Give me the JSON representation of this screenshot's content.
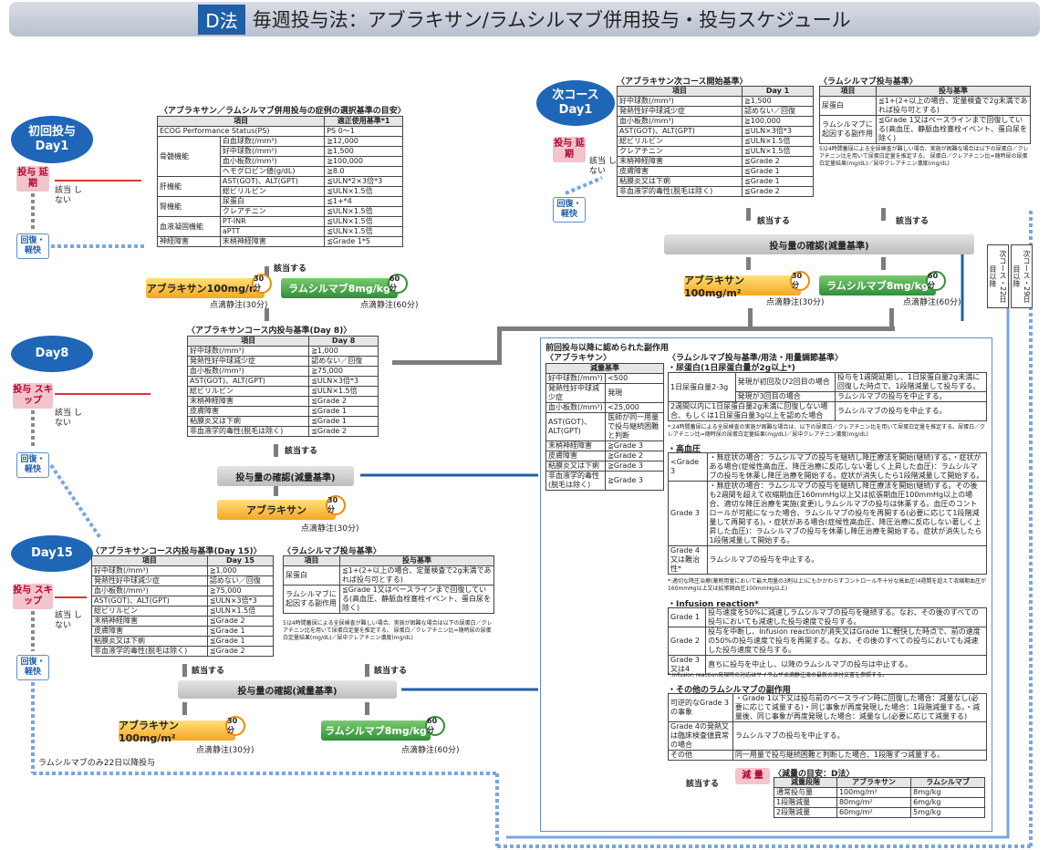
{
  "banner": {
    "tag": "D法",
    "title": "毎週投与法：アブラキサン/ラムシルマブ併用投与・投与スケジュール"
  },
  "labels": {
    "day1": "初回投与 Day1",
    "day8": "Day8",
    "day15": "Day15",
    "next_day1": "次コース Day1",
    "delay": "投与 延期",
    "skip": "投与 スキップ",
    "recovery": "回復・ 軽快",
    "applicable": "該当する",
    "not_applicable": "該当 しない",
    "dose_check": "投与量の確認(減量基準)",
    "next_22": "次コース・22日目以降",
    "next_29": "次コース・29日目以降",
    "ram_only_22": "ラムシルマブのみ22日以降投与",
    "badge30": "30分",
    "badge60": "60分"
  },
  "drugs": {
    "abx100": "アブラキサン100mg/m²",
    "ram8": "ラムシルマブ8mg/kg",
    "abx": "アブラキサン",
    "drip30": "点滴静注(30分)",
    "drip60": "点滴静注(60分)",
    "reduce": "減 量"
  },
  "sel_criteria": {
    "title": "〈アブラキサン／ラムシルマブ併用投与の症例の選択基準の目安〉",
    "head": [
      "項目",
      "適正使用基準*1"
    ],
    "rows": [
      [
        "ECOG Performance Status(PS)",
        "",
        "PS 0〜1"
      ],
      [
        "骨髄機能",
        "白血球数(/mm³)",
        "≧12,000"
      ],
      [
        "",
        "好中球数(/mm³)",
        "≧1,500"
      ],
      [
        "",
        "血小板数(/mm³)",
        "≧100,000"
      ],
      [
        "",
        "ヘモグロビン値(g/dL)",
        "≧8.0"
      ],
      [
        "肝機能",
        "AST(GOT)、ALT(GPT)",
        "≦ULN*2×3倍*3"
      ],
      [
        "",
        "総ビリルビン",
        "≦ULN×1.5倍"
      ],
      [
        "腎機能",
        "尿蛋白",
        "≦1+*4"
      ],
      [
        "",
        "クレアチニン",
        "≦ULN×1.5倍"
      ],
      [
        "血液凝固機能",
        "PT-INR",
        "≦ULN×1.5倍"
      ],
      [
        "",
        "aPTT",
        "≦ULN×1.5倍"
      ],
      [
        "神経障害",
        "末梢神経障害",
        "≦Grade 1*5"
      ]
    ]
  },
  "abx_day8": {
    "title": "〈アブラキサンコース内投与基準(Day 8)〉",
    "head": [
      "項目",
      "Day 8"
    ],
    "rows": [
      [
        "好中球数(/mm³)",
        "≧1,000"
      ],
      [
        "発熱性好中球減少症",
        "認めない／回復"
      ],
      [
        "血小板数(/mm³)",
        "≧75,000"
      ],
      [
        "AST(GOT)、ALT(GPT)",
        "≦ULN×3倍*3"
      ],
      [
        "総ビリルビン",
        "≦ULN×1.5倍"
      ],
      [
        "末梢神経障害",
        "≦Grade 2"
      ],
      [
        "皮膚障害",
        "≦Grade 1"
      ],
      [
        "粘膜炎又は下痢",
        "≦Grade 1"
      ],
      [
        "非血液学的毒性(脱毛は除く)",
        "≦Grade 2"
      ]
    ]
  },
  "abx_day15": {
    "title": "〈アブラキサンコース内投与基準(Day 15)〉",
    "head": [
      "項目",
      "Day 15"
    ],
    "rows": [
      [
        "好中球数(/mm³)",
        "≧1,000"
      ],
      [
        "発熱性好中球減少症",
        "認めない／回復"
      ],
      [
        "血小板数(/mm³)",
        "≧75,000"
      ],
      [
        "AST(GOT)、ALT(GPT)",
        "≦ULN×3倍*3"
      ],
      [
        "総ビリルビン",
        "≦ULN×1.5倍"
      ],
      [
        "末梢神経障害",
        "≦Grade 2"
      ],
      [
        "皮膚障害",
        "≦Grade 1"
      ],
      [
        "粘膜炎又は下痢",
        "≦Grade 1"
      ],
      [
        "非血液学的毒性(脱毛は除く)",
        "≦Grade 2"
      ]
    ]
  },
  "abx_next": {
    "title": "〈アブラキサン次コース開始基準〉",
    "head": [
      "項目",
      "Day 1"
    ],
    "rows": [
      [
        "好中球数(/mm³)",
        "≧1,500"
      ],
      [
        "発熱性好中球減少症",
        "認めない／回復"
      ],
      [
        "血小板数(/mm³)",
        "≧100,000"
      ],
      [
        "AST(GOT)、ALT(GPT)",
        "≦ULN×3倍*3"
      ],
      [
        "総ビリルビン",
        "≦ULN×1.5倍"
      ],
      [
        "クレアチニン",
        "≦ULN×1.5倍"
      ],
      [
        "末梢神経障害",
        "≦Grade 2"
      ],
      [
        "皮膚障害",
        "≦Grade 1"
      ],
      [
        "粘膜炎又は下痢",
        "≦Grade 1"
      ],
      [
        "非血液学的毒性(脱毛は除く)",
        "≦Grade 2"
      ]
    ]
  },
  "ram_crit": {
    "title": "〈ラムシルマブ投与基準〉",
    "head": [
      "項目",
      "投与基準"
    ],
    "rows": [
      [
        "尿蛋白",
        "≦1+(2+以上の場合、定量検査で2g未満であれば投与可とする)"
      ],
      [
        "ラムシルマブに起因する副作用",
        "≦Grade 1又はベースラインまで回復している(高血圧、静脈血栓塞栓イベント、蛋白尿を除く)"
      ]
    ],
    "note": "5)24時間蓄尿による全尿検査が難しい場合、実施が困難な場合は以下の尿蛋白／クレアチニン比を用いて尿蛋白定量を推定する。 尿蛋白／クレアチニン比=随時尿の尿蛋白定量結果(mg/dL)／尿中クレアチニン濃度(mg/dL)"
  },
  "adverse": {
    "title": "前回投与以降に認められた副作用",
    "abx_label": "〈アブラキサン〉",
    "abx_head": "減量基準",
    "abx_rows": [
      [
        "好中球数(/mm³)",
        "<500"
      ],
      [
        "発熱性好中球減少症",
        "発現"
      ],
      [
        "血小板数(/mm³)",
        "<25,000"
      ],
      [
        "AST(GOT)、ALT(GPT)",
        "医師が同一用量で投与継続困難と判断"
      ],
      [
        "末梢神経障害",
        "≧Grade 3"
      ],
      [
        "皮膚障害",
        "≧Grade 2"
      ],
      [
        "粘膜炎又は下痢",
        "≧Grade 3"
      ],
      [
        "非血液学的毒性(脱毛は除く)",
        "≧Grade 3"
      ]
    ],
    "ram_title": "〈ラムシルマブ投与基準/用法・用量調節基準〉",
    "proteinuria_title": "・尿蛋白(1日尿蛋白量が2g以上*)",
    "proteinuria": [
      [
        "1日尿蛋白量2-3g",
        "発現が初回及び2回目の場合",
        "投与を1週間延期し、1日尿蛋白量2g未満に回復した時点で、1段階減量して投与する。"
      ],
      [
        "",
        "発現が3回目の場合",
        "ラムシルマブの投与を中止する。"
      ],
      [
        "2週間以内に1日尿蛋白量2g未満に回復しない場合、もしくは1日尿蛋白量3g以上を認めた場合",
        "",
        "ラムシルマブの投与を中止する。"
      ]
    ],
    "proteinuria_note": "*:24時間蓄尿による全尿検査の実施が困難な場合は、以下の尿蛋白／クレアチニン比を用いて尿蛋白定量を推定する。尿蛋白／クレアチニン比=随時尿の尿蛋白定量結果(mg/dL)／尿中クレアチニン濃度(mg/dL)",
    "hyper_title": "・高血圧",
    "hyper": [
      [
        "<Grade 3",
        "・無症状の場合：ラムシルマブの投与を継続し降圧療法を開始(継続)する。・症状がある場合(症候性高血圧、降圧治療に反応しない著しく上昇した血圧)：ラムシルマブの投与を休薬し降圧治療を開始する。症状が消失したら1段階減量して開始する。"
      ],
      [
        "Grade 3",
        "・無症状の場合：ラムシルマブの投与を継続し降圧療法を開始(継続)する。その後も2週間を超えて収縮期血圧160mmHg以上又は拡張期血圧100mmHg以上の場合、適切な降圧治療を実施(変更)しラムシルマブの投与は休薬する。血圧のコントロールが可能になった場合、ラムシルマブの投与を再開する(必要に応じて1段階減量して再開する)。・症状がある場合(症候性高血圧、降圧治療に反応しない著しく上昇した血圧)：ラムシルマブの投与を休薬し降圧治療を開始する。症状が消失したら1段階減量して開始する。"
      ],
      [
        "Grade 4又は難治性*",
        "ラムシルマブの投与を中止する。"
      ]
    ],
    "hyper_note": "*:適切な降圧治療(薬剤用量において最大用量の3剤以上)にもかかわらずコントロール不十分な高血圧(4週間を超えて収縮期血圧が160mmHg以上又は拡張期血圧100mmHg以上)",
    "infusion_title": "・Infusion reaction*",
    "infusion": [
      [
        "Grade 1",
        "投与速度を50%に減速しラムシルマブの投与を継続する。なお、その後のすべての投与においても減速した投与速度で投与する。"
      ],
      [
        "Grade 2",
        "投与を中断し、Infusion reactionが消失又はGrade 1に軽快した時点で、前の速度の50%の投与速度で投与を再開する。なお、その後のすべての投与においても減速した投与速度で投与する。"
      ],
      [
        "Grade 3又は4",
        "直ちに投与を中止し、以降のラムシルマブの投与は中止する。"
      ]
    ],
    "infusion_note": "*:Infusion reaction発現時の対応はサイラムザ点滴静注液の最新の添付文書を参照する。",
    "other_title": "・その他のラムシルマブの副作用",
    "other": [
      [
        "可逆的なGrade 3の事象",
        "・Grade 1以下又は投与前のベースライン時に回復した場合：減量なし(必要に応じて減量する)・同じ事象が再度発現した場合：1段階減量する。・減量後、同じ事象が再度発現した場合：減量なし(必要に応じて減量する)"
      ],
      [
        "Grade 4の発熱又は臨床検査値異常の場合",
        "ラムシルマブの投与を中止する。"
      ],
      [
        "その他",
        "同一用量で投与継続困難と判断した場合、1段階ずつ減量する。"
      ]
    ]
  },
  "reduction": {
    "title": "〈減量の目安：D法〉",
    "head": [
      "減量段階",
      "アブラキサン",
      "ラムシルマブ"
    ],
    "rows": [
      [
        "通常投与量",
        "100mg/m²",
        "8mg/kg"
      ],
      [
        "1段階減量",
        "80mg/m²",
        "6mg/kg"
      ],
      [
        "2段階減量",
        "60mg/m²",
        "5mg/kg"
      ]
    ]
  }
}
